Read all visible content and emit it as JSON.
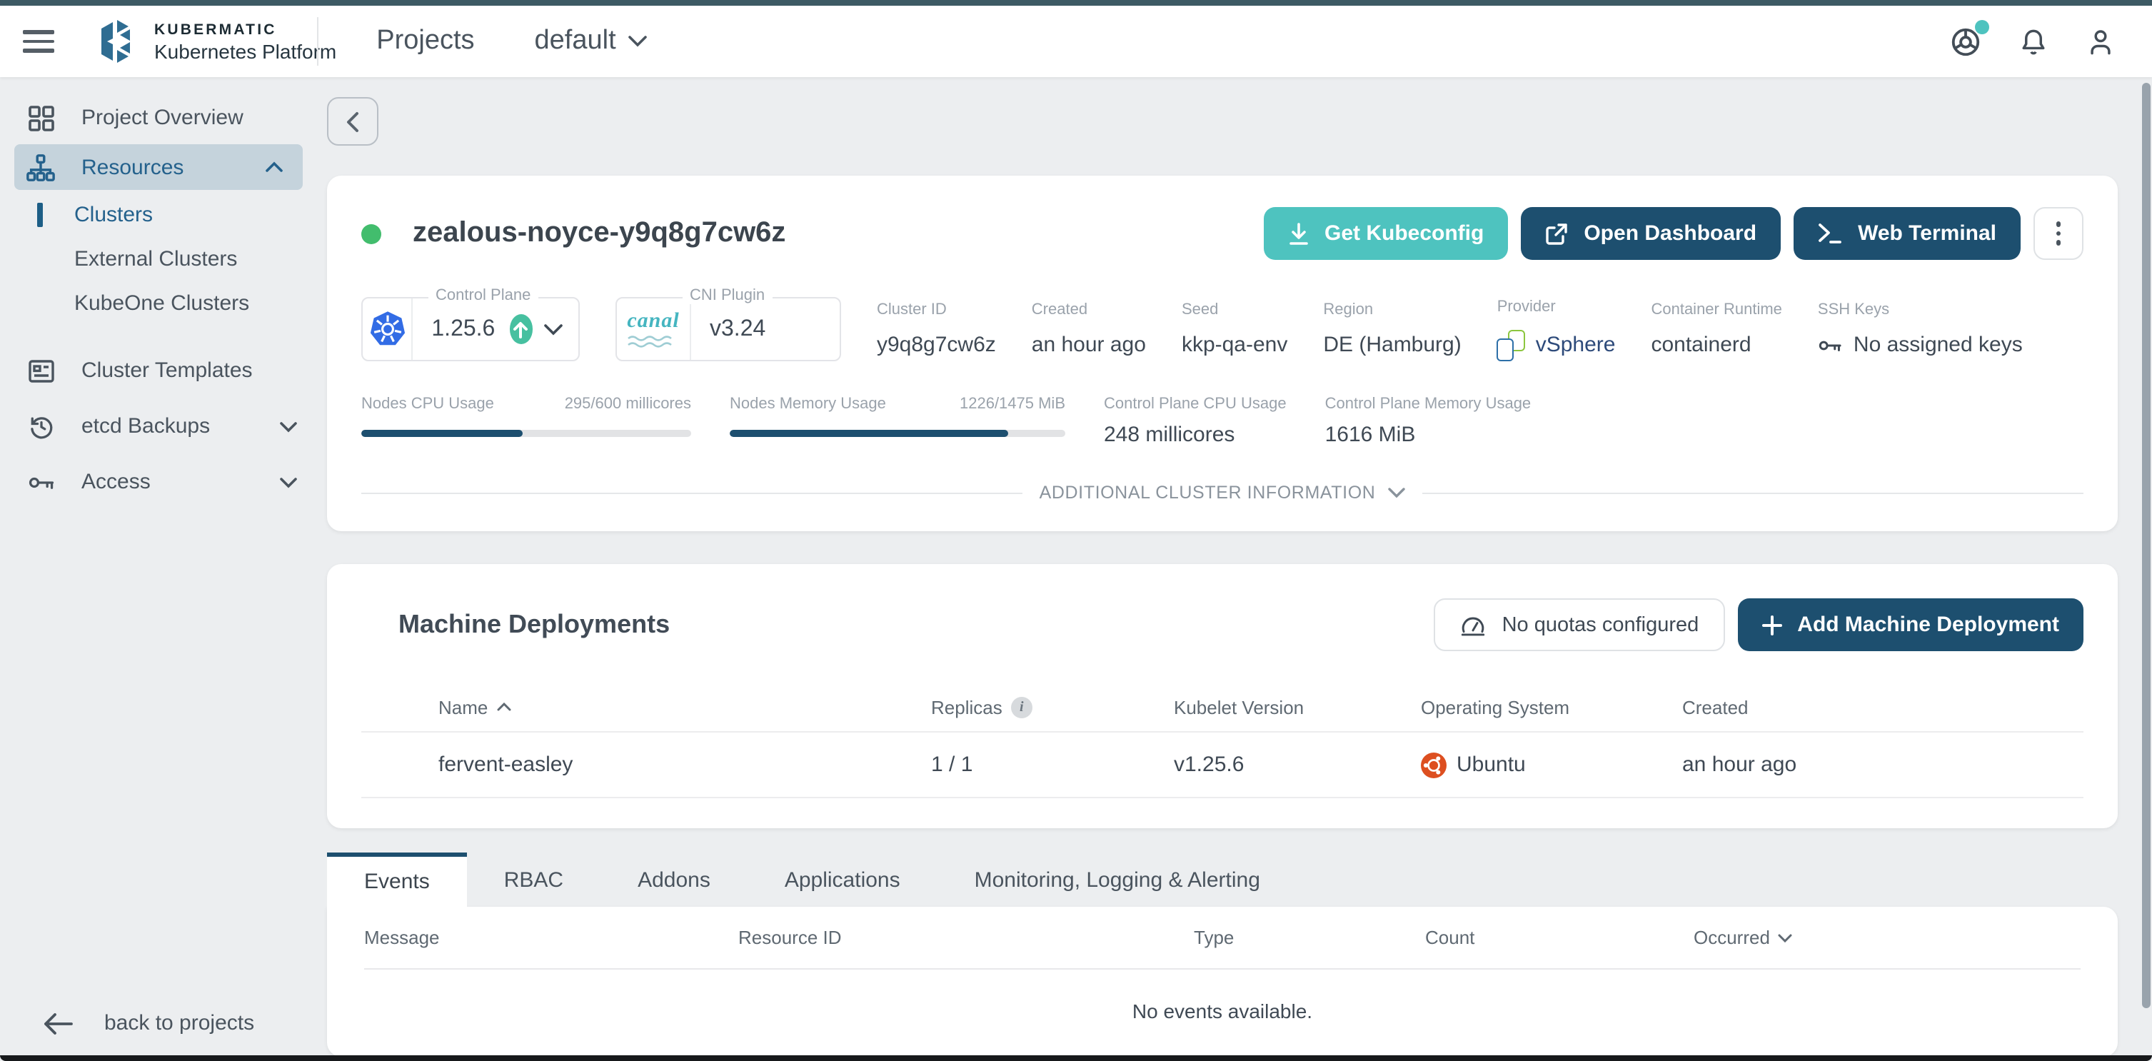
{
  "topbar": {
    "brand_line1": "KUBERMATIC",
    "brand_line2": "Kubernetes Platform",
    "nav_projects": "Projects",
    "project_selector": "default"
  },
  "sidebar": {
    "items": {
      "project_overview": "Project Overview",
      "resources": "Resources",
      "clusters": "Clusters",
      "external_clusters": "External Clusters",
      "kubeone_clusters": "KubeOne Clusters",
      "cluster_templates": "Cluster Templates",
      "etcd_backups": "etcd Backups",
      "access": "Access"
    },
    "back_to_projects": "back to projects"
  },
  "cluster": {
    "name": "zealous-noyce-y9q8g7cw6z",
    "actions": {
      "kubeconfig": "Get Kubeconfig",
      "dashboard": "Open Dashboard",
      "terminal": "Web Terminal"
    },
    "control_plane": {
      "label": "Control Plane",
      "version": "1.25.6"
    },
    "cni": {
      "label": "CNI Plugin",
      "name": "canal",
      "version": "v3.24"
    },
    "details": [
      {
        "label": "Cluster ID",
        "value": "y9q8g7cw6z"
      },
      {
        "label": "Created",
        "value": "an hour ago"
      },
      {
        "label": "Seed",
        "value": "kkp-qa-env"
      },
      {
        "label": "Region",
        "value": "DE (Hamburg)"
      },
      {
        "label": "Provider",
        "value": "vSphere"
      },
      {
        "label": "Container Runtime",
        "value": "containerd"
      },
      {
        "label": "SSH Keys",
        "value": "No assigned keys"
      }
    ],
    "usage": {
      "nodes_cpu": {
        "label": "Nodes CPU Usage",
        "value": "295/600 millicores",
        "percent": 49
      },
      "nodes_memory": {
        "label": "Nodes Memory Usage",
        "value": "1226/1475 MiB",
        "percent": 83
      },
      "cp_cpu": {
        "label": "Control Plane CPU Usage",
        "value": "248 millicores"
      },
      "cp_memory": {
        "label": "Control Plane Memory Usage",
        "value": "1616 MiB"
      }
    },
    "additional_info": "ADDITIONAL CLUSTER INFORMATION"
  },
  "machine_deployments": {
    "title": "Machine Deployments",
    "quota_button": "No quotas configured",
    "add_button": "Add Machine Deployment",
    "columns": [
      "Name",
      "Replicas",
      "Kubelet Version",
      "Operating System",
      "Created"
    ],
    "rows": [
      {
        "name": "fervent-easley",
        "replicas": "1 / 1",
        "kubelet": "v1.25.6",
        "os": "Ubuntu",
        "created": "an hour ago"
      }
    ]
  },
  "tabs": [
    "Events",
    "RBAC",
    "Addons",
    "Applications",
    "Monitoring, Logging & Alerting"
  ],
  "events": {
    "columns": [
      "Message",
      "Resource ID",
      "Type",
      "Count",
      "Occurred"
    ],
    "empty": "No events available."
  },
  "colors": {
    "accent_teal": "#4ec3bf",
    "primary_blue": "#1d4f6f",
    "status_green": "#42bd6d",
    "k8s_blue": "#326ce5",
    "ubuntu_orange": "#dd4f20"
  }
}
